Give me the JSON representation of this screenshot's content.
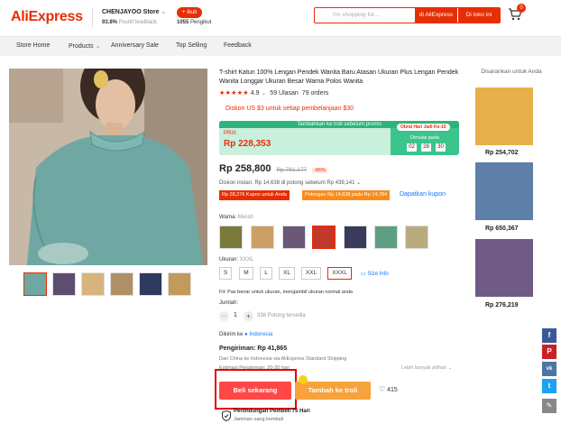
{
  "header": {
    "logo": "AliExpress",
    "store_name": "CHENJAYOO Store",
    "store_feedback_pct": "93.8%",
    "store_feedback_label": "Positif feedback",
    "follow_label": "+ Ikuti",
    "followers_count": "1055",
    "followers_label": "Pengikut",
    "search_placeholder": "I'm shopping for...",
    "search_aliexpress_label": "di AliExpress",
    "search_store_label": "Di toko ini",
    "cart_count": "0"
  },
  "nav": [
    "Store Home",
    "Products",
    "Anniversary Sale",
    "Top Selling",
    "Feedback"
  ],
  "product": {
    "title": "T-shirt Katun 100% Lengan Pendek Wanita Baru Atasan Ukuran Plus Lengan Pendek Wanita Longgar Ukuran Besar Warna Polos Wanita",
    "rating": "4.9",
    "reviews": "59 Ulasan",
    "orders": "79 orders",
    "discount_line": "Diskon US $3 untuk setiap pembelanjaan $30",
    "promo": {
      "top_text": "Tambahkan ke troli sebelum promo",
      "price_label": "PRIX",
      "price": "Rp 228,353",
      "badge": "Obral Hari Jadi Ke-10",
      "ends_label": "Dimulai pada",
      "timer": [
        "02",
        "28",
        "30"
      ]
    },
    "price": "Rp 258,800",
    "old_price": "Rp 761,177",
    "off": "-66%",
    "instant_discount": "Diskon instan: Rp 14,638 di potong sebelum Rp 439,141",
    "coupon1": "Rp 28,276 Kupon untuk Anda",
    "coupon2": "Potongan Rp 14,638 pada Rp 14,784",
    "get_coupon": "Dapatkan kupon",
    "color_label": "Warna:",
    "color_value": "Merah",
    "colors": [
      {
        "name": "olive",
        "hex": "#7a7a3a"
      },
      {
        "name": "camel",
        "hex": "#caa064"
      },
      {
        "name": "purple",
        "hex": "#6a5878"
      },
      {
        "name": "red",
        "hex": "#c0392b"
      },
      {
        "name": "navy",
        "hex": "#3a3a5a"
      },
      {
        "name": "green",
        "hex": "#5e9f83"
      },
      {
        "name": "khaki",
        "hex": "#b8ab7e"
      }
    ],
    "size_label": "Ukuran:",
    "size_value": "XXXL",
    "sizes": [
      "S",
      "M",
      "L",
      "XL",
      "XXL",
      "XXXL"
    ],
    "size_info": "Size Info",
    "fit_line": "Fit: Pas benar untuk ukuran, mengambil ukuran normal anda",
    "qty_label": "Jumlah:",
    "qty_value": "1",
    "qty_available": "338 Potong tersedia",
    "ship_to_label": "Dikirim ke",
    "ship_to": "Indonesia",
    "shipping_cost": "Pengiriman: Rp 41,865",
    "ship_from": "Dari China ke Indonesia via AliExpress Standard Shipping",
    "ship_eta": "Estimasi Pengiriman: 20-30 hari",
    "more_options": "Lebih banyak pilihan",
    "buy_now": "Beli sekarang",
    "add_to_cart": "Tambah ke troli",
    "wishlist_count": "415",
    "protection_title": "Perlindungan Pembeli 75 Hari",
    "protection_sub": "Jaminan uang kembali"
  },
  "recommendations": {
    "title": "Disarankan untuk Anda",
    "items": [
      {
        "price": "Rp 254,702",
        "color": "#e8b04a"
      },
      {
        "price": "Rp 650,367",
        "color": "#5d7fa8"
      },
      {
        "price": "Rp 276,219",
        "color": "#6f5b86"
      }
    ]
  },
  "share": [
    {
      "name": "facebook-icon",
      "glyph": "f",
      "color": "#3b5998"
    },
    {
      "name": "pinterest-icon",
      "glyph": "P",
      "color": "#cb2027"
    },
    {
      "name": "vk-icon",
      "glyph": "vk",
      "color": "#4c75a3"
    },
    {
      "name": "twitter-icon",
      "glyph": "t",
      "color": "#1da1f2"
    },
    {
      "name": "edit-icon",
      "glyph": "✎",
      "color": "#888888"
    }
  ]
}
